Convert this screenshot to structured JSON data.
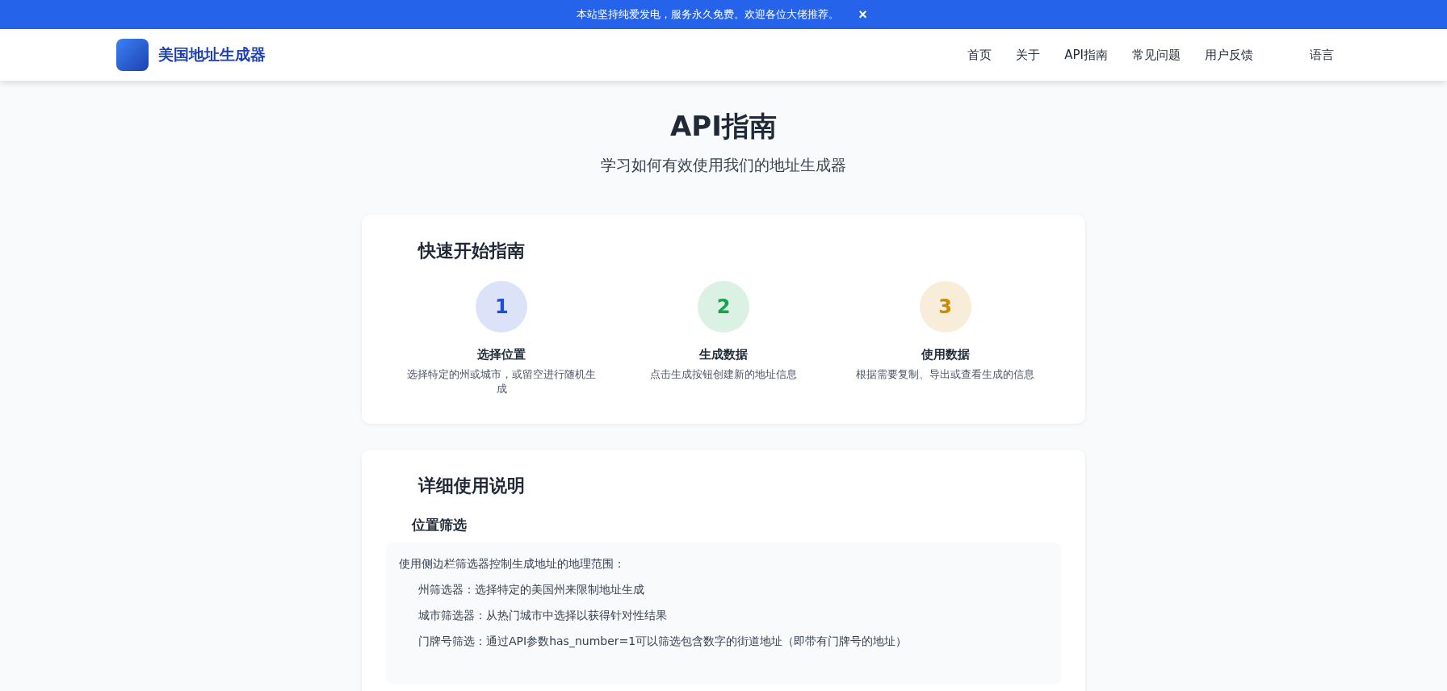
{
  "notice": {
    "text": "本站坚持纯爱发电，服务永久免费。欢迎各位大佬推荐。",
    "close": "×"
  },
  "header": {
    "brand": "美国地址生成器",
    "nav": [
      "首页",
      "关于",
      "API指南",
      "常见问题",
      "用户反馈",
      "语言"
    ]
  },
  "hero": {
    "title": "API指南",
    "subtitle": "学习如何有效使用我们的地址生成器"
  },
  "quick_start": {
    "title": "快速开始指南",
    "steps": [
      {
        "number": "1",
        "title": "选择位置",
        "text": "选择特定的州或城市，或留空进行随机生成",
        "color": "#1d4ed8"
      },
      {
        "number": "2",
        "title": "生成数据",
        "text": "点击生成按钮创建新的地址信息",
        "color": "#16a34a"
      },
      {
        "number": "3",
        "title": "使用数据",
        "text": "根据需要复制、导出或查看生成的信息",
        "color": "#ca8a04"
      }
    ]
  },
  "details": {
    "title": "详细使用说明",
    "section": {
      "title": "位置筛选",
      "intro": "使用侧边栏筛选器控制生成地址的地理范围：",
      "items": [
        "州筛选器：选择特定的美国州来限制地址生成",
        "城市筛选器：从热门城市中选择以获得针对性结果",
        "门牌号筛选：通过API参数has_number=1可以筛选包含数字的街道地址（即带有门牌号的地址）"
      ]
    }
  }
}
